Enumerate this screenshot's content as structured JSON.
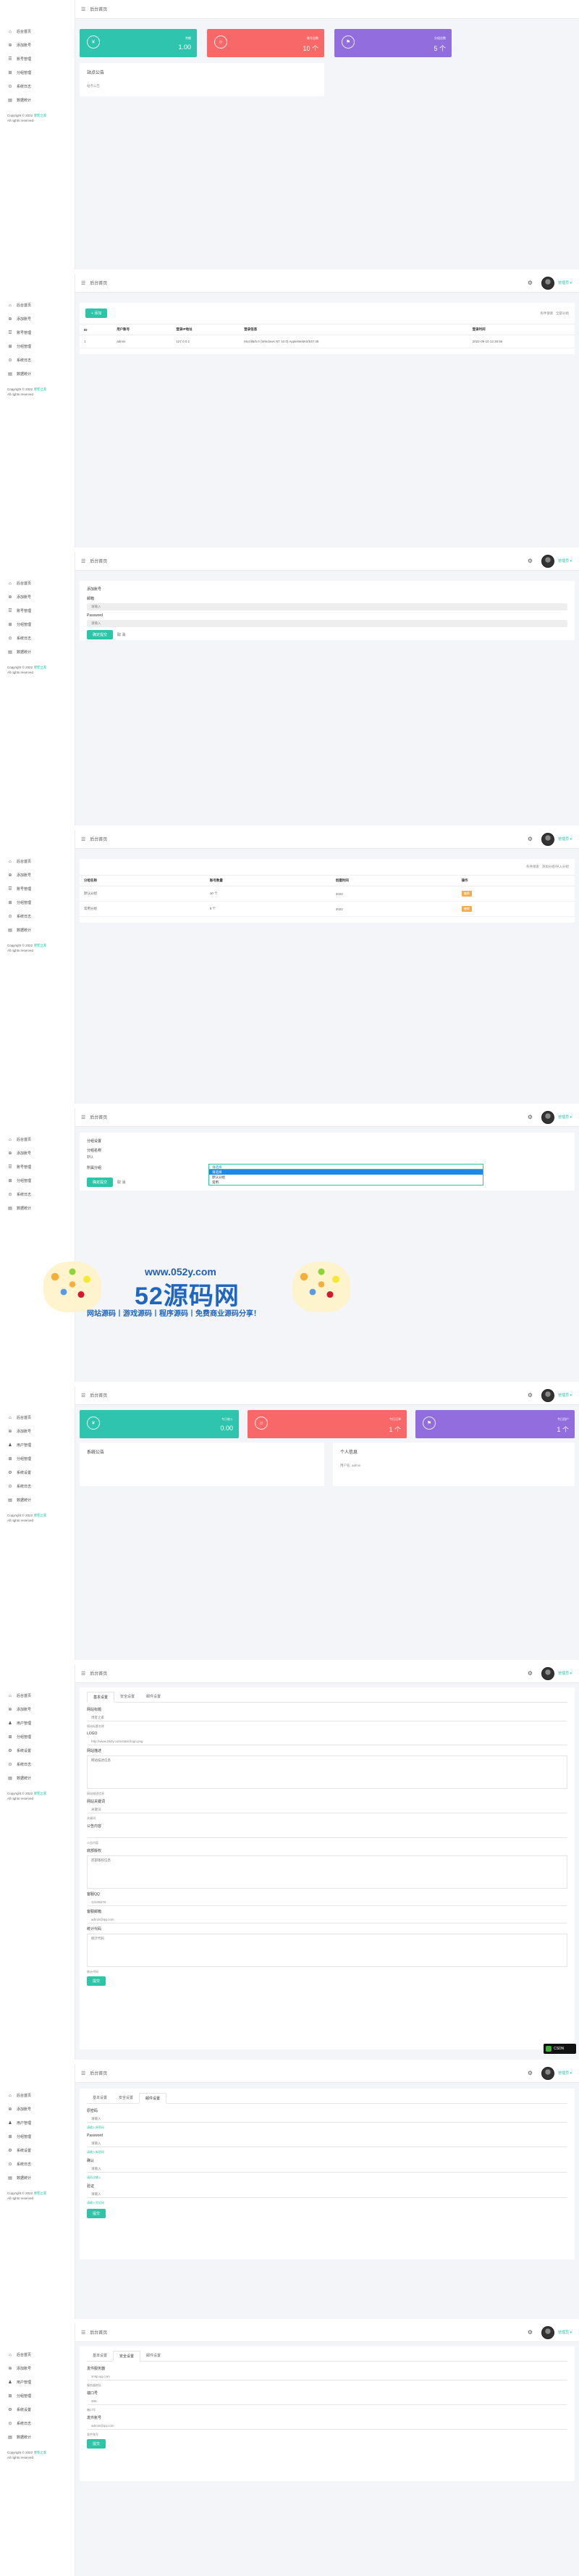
{
  "app": {
    "title": "后台首页",
    "user_name": "管理员 ▾",
    "copyright_prefix": "Copyright © 2022",
    "copyright_link": "博客之家",
    "copyright_suffix": "All rights reserved"
  },
  "nav_admin": [
    {
      "label": "后台首页",
      "icon": "home-icon",
      "glyph": "⌂"
    },
    {
      "label": "添加账号",
      "icon": "plus-icon",
      "glyph": "⊕"
    },
    {
      "label": "账号管理",
      "icon": "list-icon",
      "glyph": "☰"
    },
    {
      "label": "分组管理",
      "icon": "group-icon",
      "glyph": "⊞"
    },
    {
      "label": "系统日志",
      "icon": "log-icon",
      "glyph": "⊙"
    },
    {
      "label": "数据统计",
      "icon": "chart-icon",
      "glyph": "▤"
    }
  ],
  "nav_full": [
    {
      "label": "后台首页",
      "icon": "home-icon",
      "glyph": "⌂"
    },
    {
      "label": "添加账号",
      "icon": "plus-icon",
      "glyph": "⊕"
    },
    {
      "label": "用户管理",
      "icon": "user-icon",
      "glyph": "♟"
    },
    {
      "label": "分组管理",
      "icon": "group-icon",
      "glyph": "⊞"
    },
    {
      "label": "系统设置",
      "icon": "gear-icon",
      "glyph": "⚙"
    },
    {
      "label": "系统日志",
      "icon": "log-icon",
      "glyph": "⊙"
    },
    {
      "label": "数据统计",
      "icon": "chart-icon",
      "glyph": "▤"
    }
  ],
  "dashboard": {
    "stats": [
      {
        "label": "余额",
        "value": "1.00",
        "color": "#2ec4ad"
      },
      {
        "label": "账号总数",
        "value": "10 个",
        "color": "#f96868"
      },
      {
        "label": "分组总数",
        "value": "5 个",
        "color": "#926dde"
      }
    ],
    "notice_title": "站点公告",
    "notice_body": "站点公告"
  },
  "logs": {
    "add_button": "+ 添加",
    "search_links": [
      "条件搜索",
      "全部分组"
    ],
    "columns": [
      "ID",
      "用户账号",
      "登录IP地址",
      "登录信息",
      "登录时间"
    ],
    "rows": [
      [
        "1",
        "admin",
        "127.0.0.1",
        "Mozilla/5.0 (Windows NT 10.0) AppleWebKit/537.36",
        "2022-09-10 12:30:56"
      ]
    ]
  },
  "add_account": {
    "title": "添加账号",
    "email_label": "邮箱",
    "email_placeholder": "请输入",
    "password_label": "Password",
    "password_placeholder": "请输入",
    "submit": "确定提交",
    "cancel": "取 消"
  },
  "group_list": {
    "search_links": [
      "条件搜索",
      "添加分组/导入分组"
    ],
    "columns": [
      "分组名称",
      "账号数量",
      "创建时间",
      "操作"
    ],
    "rows": [
      [
        "默认分组",
        "10 个",
        "2022",
        "编辑"
      ],
      [
        "常用分组",
        "5 个",
        "2022",
        "编辑"
      ]
    ]
  },
  "group_form": {
    "title": "分组设置",
    "name_label": "分组名称",
    "name_value": "默认",
    "type_label": "所属分组",
    "select_value": "请选择",
    "options": [
      "请选择",
      "默认分组",
      "常用"
    ],
    "submit": "确定提交",
    "cancel": "取 消"
  },
  "watermark": {
    "url": "www.052y.com",
    "brand": "52源码网",
    "slogan": "网站源码丨游戏源码丨程序源码丨免费商业源码分享！"
  },
  "dashboard2": {
    "stats": [
      {
        "label": "今日收入",
        "value": "0.00",
        "color": "#2ec4ad"
      },
      {
        "label": "今日订单",
        "value": "1 个",
        "color": "#f96868"
      },
      {
        "label": "今日用户",
        "value": "1 个",
        "color": "#926dde"
      }
    ],
    "notice_title": "系统公告",
    "info_title": "个人信息",
    "info_body": "用户名: admin"
  },
  "settings": {
    "tabs": [
      "基本设置",
      "安全设置",
      "邮件设置"
    ],
    "fields": [
      {
        "label": "网站标题",
        "value": "博客之家",
        "hint": "网站标题名称"
      },
      {
        "label": "LOGO",
        "value": "http://www.052y.com/static/logo.png",
        "hint": ""
      },
      {
        "label": "网站描述",
        "value": "网站描述信息",
        "hint": "网站描述信息"
      },
      {
        "label": "网站关键词",
        "value": "关键词",
        "hint": "关键词"
      },
      {
        "label": "公告内容",
        "value": "",
        "hint": "公告内容"
      },
      {
        "label": "底部版权",
        "value": "底部版权信息",
        "hint": ""
      },
      {
        "label": "客服QQ",
        "value": "12345678",
        "hint": ""
      },
      {
        "label": "客服邮箱",
        "value": "admin@qq.com",
        "hint": ""
      },
      {
        "label": "统计代码",
        "value": "统计代码",
        "hint": "统计代码"
      }
    ],
    "submit": "提交",
    "wechat_label": "CSDN"
  },
  "security": {
    "tabs": [
      "基本设置",
      "安全设置",
      "邮件设置"
    ],
    "fields": [
      {
        "label": "原密码",
        "placeholder": "请输入",
        "hint": "请输入原密码"
      },
      {
        "label": "Password",
        "placeholder": "请输入",
        "hint": "请输入新密码"
      },
      {
        "label": "确认",
        "placeholder": "请输入",
        "hint": "请再次输入"
      },
      {
        "label": "验证",
        "placeholder": "请输入",
        "hint": "请输入验证码"
      }
    ],
    "submit": "提交"
  },
  "mail": {
    "tabs": [
      "基本设置",
      "安全设置",
      "邮件设置"
    ],
    "fields": [
      {
        "label": "发件服务器",
        "value": "smtp.qq.com",
        "hint": "服务器地址"
      },
      {
        "label": "端口号",
        "value": "465",
        "hint": "端口号"
      },
      {
        "label": "发件账号",
        "value": "admin@qq.com",
        "hint": "发件账号"
      }
    ],
    "submit": "提交"
  }
}
